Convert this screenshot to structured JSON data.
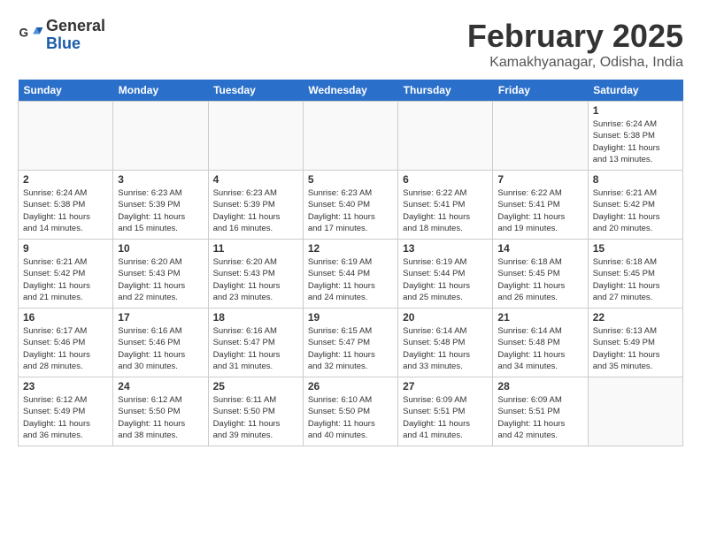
{
  "header": {
    "logo_line1": "General",
    "logo_line2": "Blue",
    "month_title": "February 2025",
    "location": "Kamakhyanagar, Odisha, India"
  },
  "days_of_week": [
    "Sunday",
    "Monday",
    "Tuesday",
    "Wednesday",
    "Thursday",
    "Friday",
    "Saturday"
  ],
  "weeks": [
    [
      {
        "day": "",
        "info": ""
      },
      {
        "day": "",
        "info": ""
      },
      {
        "day": "",
        "info": ""
      },
      {
        "day": "",
        "info": ""
      },
      {
        "day": "",
        "info": ""
      },
      {
        "day": "",
        "info": ""
      },
      {
        "day": "1",
        "info": "Sunrise: 6:24 AM\nSunset: 5:38 PM\nDaylight: 11 hours\nand 13 minutes."
      }
    ],
    [
      {
        "day": "2",
        "info": "Sunrise: 6:24 AM\nSunset: 5:38 PM\nDaylight: 11 hours\nand 14 minutes."
      },
      {
        "day": "3",
        "info": "Sunrise: 6:23 AM\nSunset: 5:39 PM\nDaylight: 11 hours\nand 15 minutes."
      },
      {
        "day": "4",
        "info": "Sunrise: 6:23 AM\nSunset: 5:39 PM\nDaylight: 11 hours\nand 16 minutes."
      },
      {
        "day": "5",
        "info": "Sunrise: 6:23 AM\nSunset: 5:40 PM\nDaylight: 11 hours\nand 17 minutes."
      },
      {
        "day": "6",
        "info": "Sunrise: 6:22 AM\nSunset: 5:41 PM\nDaylight: 11 hours\nand 18 minutes."
      },
      {
        "day": "7",
        "info": "Sunrise: 6:22 AM\nSunset: 5:41 PM\nDaylight: 11 hours\nand 19 minutes."
      },
      {
        "day": "8",
        "info": "Sunrise: 6:21 AM\nSunset: 5:42 PM\nDaylight: 11 hours\nand 20 minutes."
      }
    ],
    [
      {
        "day": "9",
        "info": "Sunrise: 6:21 AM\nSunset: 5:42 PM\nDaylight: 11 hours\nand 21 minutes."
      },
      {
        "day": "10",
        "info": "Sunrise: 6:20 AM\nSunset: 5:43 PM\nDaylight: 11 hours\nand 22 minutes."
      },
      {
        "day": "11",
        "info": "Sunrise: 6:20 AM\nSunset: 5:43 PM\nDaylight: 11 hours\nand 23 minutes."
      },
      {
        "day": "12",
        "info": "Sunrise: 6:19 AM\nSunset: 5:44 PM\nDaylight: 11 hours\nand 24 minutes."
      },
      {
        "day": "13",
        "info": "Sunrise: 6:19 AM\nSunset: 5:44 PM\nDaylight: 11 hours\nand 25 minutes."
      },
      {
        "day": "14",
        "info": "Sunrise: 6:18 AM\nSunset: 5:45 PM\nDaylight: 11 hours\nand 26 minutes."
      },
      {
        "day": "15",
        "info": "Sunrise: 6:18 AM\nSunset: 5:45 PM\nDaylight: 11 hours\nand 27 minutes."
      }
    ],
    [
      {
        "day": "16",
        "info": "Sunrise: 6:17 AM\nSunset: 5:46 PM\nDaylight: 11 hours\nand 28 minutes."
      },
      {
        "day": "17",
        "info": "Sunrise: 6:16 AM\nSunset: 5:46 PM\nDaylight: 11 hours\nand 30 minutes."
      },
      {
        "day": "18",
        "info": "Sunrise: 6:16 AM\nSunset: 5:47 PM\nDaylight: 11 hours\nand 31 minutes."
      },
      {
        "day": "19",
        "info": "Sunrise: 6:15 AM\nSunset: 5:47 PM\nDaylight: 11 hours\nand 32 minutes."
      },
      {
        "day": "20",
        "info": "Sunrise: 6:14 AM\nSunset: 5:48 PM\nDaylight: 11 hours\nand 33 minutes."
      },
      {
        "day": "21",
        "info": "Sunrise: 6:14 AM\nSunset: 5:48 PM\nDaylight: 11 hours\nand 34 minutes."
      },
      {
        "day": "22",
        "info": "Sunrise: 6:13 AM\nSunset: 5:49 PM\nDaylight: 11 hours\nand 35 minutes."
      }
    ],
    [
      {
        "day": "23",
        "info": "Sunrise: 6:12 AM\nSunset: 5:49 PM\nDaylight: 11 hours\nand 36 minutes."
      },
      {
        "day": "24",
        "info": "Sunrise: 6:12 AM\nSunset: 5:50 PM\nDaylight: 11 hours\nand 38 minutes."
      },
      {
        "day": "25",
        "info": "Sunrise: 6:11 AM\nSunset: 5:50 PM\nDaylight: 11 hours\nand 39 minutes."
      },
      {
        "day": "26",
        "info": "Sunrise: 6:10 AM\nSunset: 5:50 PM\nDaylight: 11 hours\nand 40 minutes."
      },
      {
        "day": "27",
        "info": "Sunrise: 6:09 AM\nSunset: 5:51 PM\nDaylight: 11 hours\nand 41 minutes."
      },
      {
        "day": "28",
        "info": "Sunrise: 6:09 AM\nSunset: 5:51 PM\nDaylight: 11 hours\nand 42 minutes."
      },
      {
        "day": "",
        "info": ""
      }
    ]
  ]
}
